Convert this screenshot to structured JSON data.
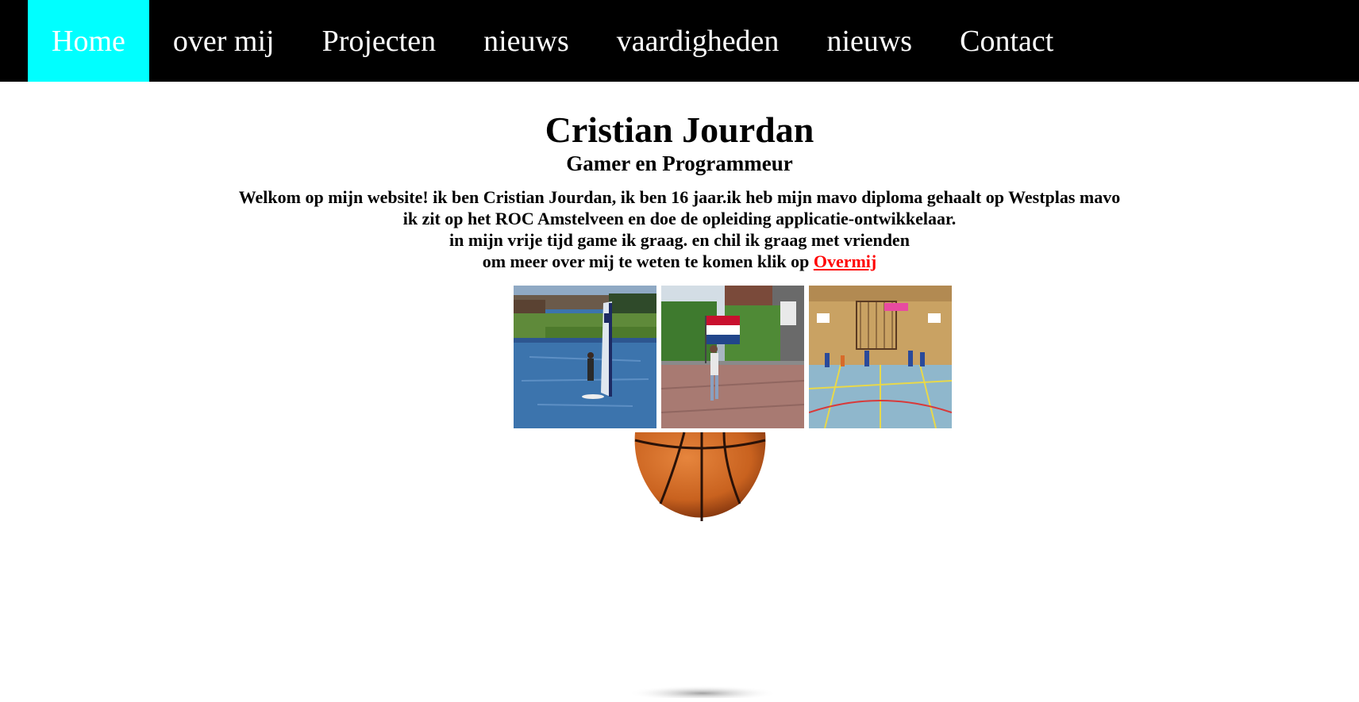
{
  "nav": {
    "items": [
      {
        "label": "Home",
        "active": true
      },
      {
        "label": "over mij",
        "active": false
      },
      {
        "label": "Projecten",
        "active": false
      },
      {
        "label": "nieuws",
        "active": false
      },
      {
        "label": "vaardigheden",
        "active": false
      },
      {
        "label": "nieuws",
        "active": false
      },
      {
        "label": "Contact",
        "active": false
      }
    ]
  },
  "header": {
    "title": "Cristian Jourdan",
    "subtitle": "Gamer en Programmeur"
  },
  "intro": {
    "line1": "Welkom op mijn website! ik ben Cristian Jourdan, ik ben 16 jaar.ik heb mijn mavo diploma gehaalt op Westplas mavo",
    "line2": "ik zit op het ROC Amstelveen en doe de opleiding applicatie-ontwikkelaar.",
    "line3": "in mijn vrije tijd game ik graag. en chil ik graag met vrienden",
    "line4_prefix": "om meer over mij te weten te komen klik op ",
    "link_label": "Overmij"
  },
  "gallery": {
    "images": [
      "windsurfing-photo",
      "flag-photo",
      "basketball-court-photo"
    ]
  },
  "colors": {
    "nav_bg": "#000000",
    "nav_active": "#00ffff",
    "link": "#ff0000"
  }
}
